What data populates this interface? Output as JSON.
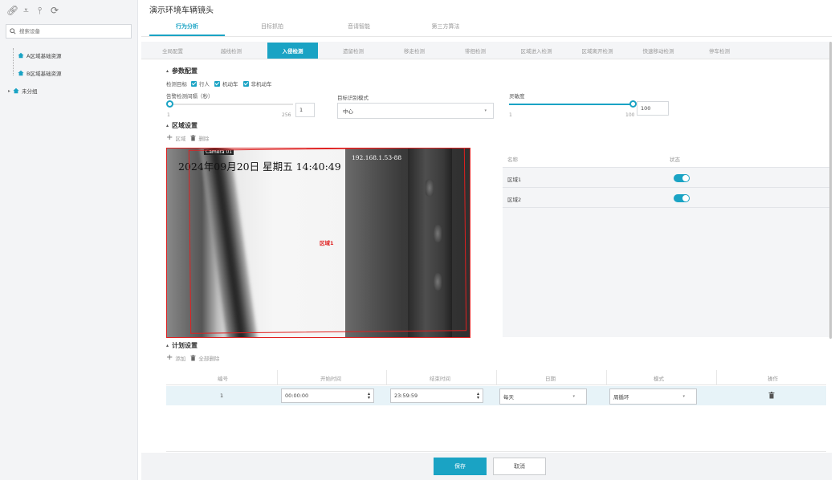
{
  "sidebar": {
    "toolbar": {
      "link_icon": "link-icon",
      "filter_icon": "filter-icon",
      "tree_icon": "org-tree-icon",
      "refresh_icon": "refresh-icon"
    },
    "search_placeholder": "搜索设备",
    "items": [
      {
        "label": "A区域基础资源"
      },
      {
        "label": "B区域基础资源"
      },
      {
        "label": "未分组"
      }
    ]
  },
  "page": {
    "title": "演示环境车辆镜头"
  },
  "top_tabs": [
    {
      "label": "行为分析",
      "active": true
    },
    {
      "label": "目标抓拍",
      "active": false
    },
    {
      "label": "音请智能",
      "active": false
    },
    {
      "label": "第三方算法",
      "active": false
    }
  ],
  "sub_tabs": [
    {
      "label": "全局配置"
    },
    {
      "label": "越线检测"
    },
    {
      "label": "入侵检测"
    },
    {
      "label": "遗留检测"
    },
    {
      "label": "移走检测"
    },
    {
      "label": "徘徊检测"
    },
    {
      "label": "区域进入检测"
    },
    {
      "label": "区域离开检测"
    },
    {
      "label": "快速移动检测"
    },
    {
      "label": "停车检测"
    }
  ],
  "params": {
    "section_title": "参数配置",
    "detect_target_label": "检测目标",
    "targets": [
      "行人",
      "机动车",
      "非机动车"
    ],
    "alarm_interval_label": "告警检测间隔（秒）",
    "alarm_min": "1",
    "alarm_max": "256",
    "alarm_value": "1",
    "alarm_level": 0.0,
    "recognition_mode_label": "目标识别模式",
    "recognition_mode_value": "中心",
    "sensitivity_label": "灵敏度",
    "sens_min": "1",
    "sens_max": "100",
    "sens_value": "100",
    "sens_level": 1.0
  },
  "region": {
    "section_title": "区域设置",
    "add_label": "区域",
    "delete_label": "删除",
    "video": {
      "datetime": "2024年09月20日  星期五  14:40:49",
      "ip": "192.168.1.53-88",
      "channel_label": "Camera 01",
      "zone_label": "区域1"
    },
    "table": {
      "headers": {
        "name": "名称",
        "status": "状态"
      },
      "rows": [
        {
          "name": "区域1",
          "enabled": true
        },
        {
          "name": "区域2",
          "enabled": true
        }
      ]
    }
  },
  "schedule": {
    "section_title": "计划设置",
    "add_label": "添加",
    "delete_all_label": "全部删除",
    "headers": {
      "index": "编号",
      "start": "开始时间",
      "end": "结束时间",
      "date": "日期",
      "mode": "模式",
      "action": "操作"
    },
    "rows": [
      {
        "index": "1",
        "start": "00:00:00",
        "end": "23:59:59",
        "date": "每天",
        "mode": "周循环"
      }
    ]
  },
  "footer": {
    "save_label": "保存",
    "cancel_label": "取消"
  },
  "colors": {
    "accent": "#1aa3c4",
    "zone_red": "#e02020"
  }
}
